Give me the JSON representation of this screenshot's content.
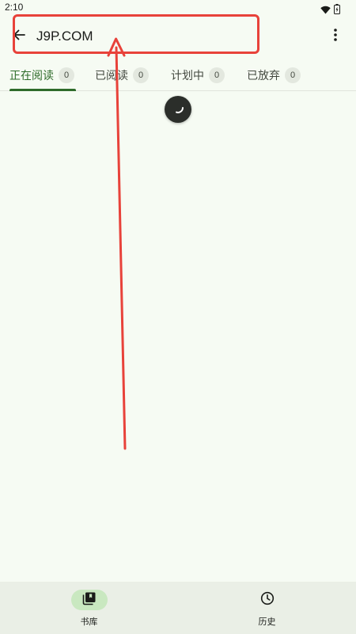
{
  "status_bar": {
    "time": "2:10",
    "icons": [
      "wifi-icon",
      "battery-icon"
    ]
  },
  "toolbar": {
    "search_value": "J9P.COM",
    "back_icon": "arrow-back-icon",
    "overflow_icon": "more-vert-icon"
  },
  "tabs": [
    {
      "label": "正在阅读",
      "count": "0",
      "active": true
    },
    {
      "label": "已阅读",
      "count": "0",
      "active": false
    },
    {
      "label": "计划中",
      "count": "0",
      "active": false
    },
    {
      "label": "已放弃",
      "count": "0",
      "active": false
    }
  ],
  "bottom_nav": [
    {
      "label": "书库",
      "icon": "library-icon",
      "active": true
    },
    {
      "label": "历史",
      "icon": "history-icon",
      "active": false
    }
  ],
  "colors": {
    "background": "#f6fbf3",
    "accent": "#2e6b2a",
    "annotation": "#e8423a",
    "nav_background": "#eaefe6",
    "nav_active_pill": "#c9e8c0"
  }
}
